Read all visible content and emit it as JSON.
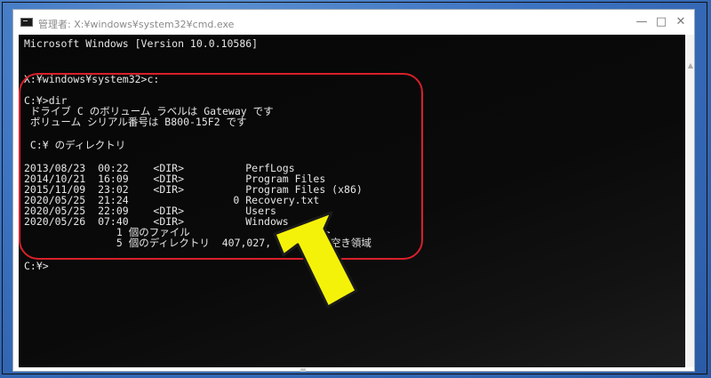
{
  "window": {
    "title": "管理者: X:¥windows¥system32¥cmd.exe",
    "minimize_glyph": "—",
    "maximize_glyph": "□",
    "close_glyph": "✕"
  },
  "console": {
    "version_line": "Microsoft Windows [Version 10.0.10586]",
    "prompt_cd": "X:¥windows¥system32>c:",
    "prompt_dir": "C:¥>dir",
    "volume_label": " ドライブ C のボリューム ラベルは Gateway です",
    "serial": " ボリューム シリアル番号は B800-15F2 です",
    "directory_of": " C:¥ のディレクトリ",
    "entries": [
      "2013/08/23  00:22    <DIR>          PerfLogs",
      "2014/10/21  16:09    <DIR>          Program Files",
      "2015/11/09  23:02    <DIR>          Program Files (x86)",
      "2020/05/25  21:24                 0 Recovery.txt",
      "2020/05/25  22:09    <DIR>          Users",
      "2020/05/26  07:40    <DIR>          Windows"
    ],
    "files_summary": "               1 個のファイル                0 バイト",
    "dirs_summary": "               5 個のディレクトリ  407,027,   バイトの空き領域",
    "final_prompt": "C:¥>"
  },
  "colors": {
    "highlight_border": "#d8202a",
    "arrow_fill": "#f5f20a",
    "arrow_stroke": "#1a1a1a",
    "text": "#e6e6e6"
  },
  "icons": {
    "app": "cmd-icon",
    "annotation": "pointer-arrow-icon"
  }
}
